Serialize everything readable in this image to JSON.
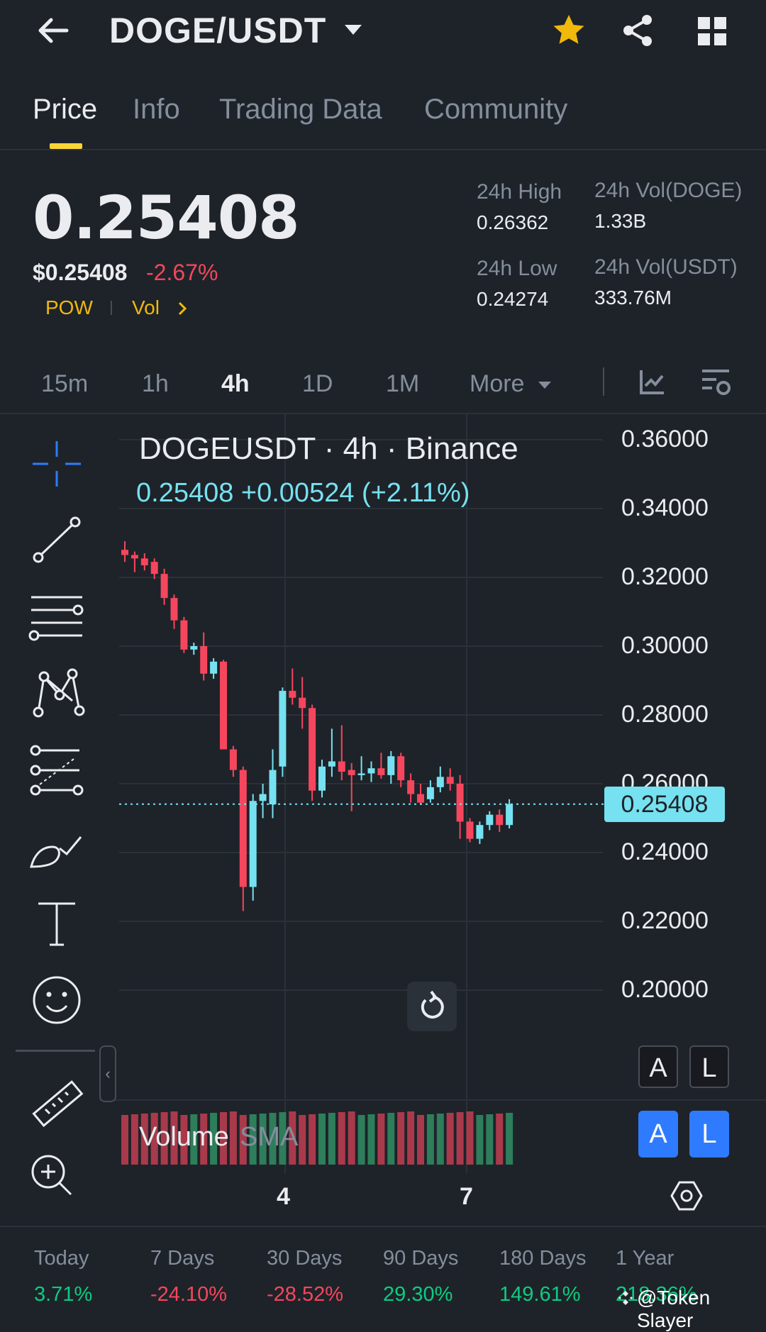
{
  "header": {
    "pair": "DOGE/USDT"
  },
  "tabs": [
    {
      "label": "Price",
      "active": true
    },
    {
      "label": "Info"
    },
    {
      "label": "Trading Data"
    },
    {
      "label": "Community"
    }
  ],
  "ticker": {
    "last_price": "0.25408",
    "usd_price": "$0.25408",
    "change": "-2.67%",
    "tag_pow": "POW",
    "tag_vol": "Vol",
    "stats": {
      "high_label": "24h High",
      "high": "0.26362",
      "low_label": "24h Low",
      "low": "0.24274",
      "vol_base_label": "24h Vol(DOGE)",
      "vol_base": "1.33B",
      "vol_quote_label": "24h Vol(USDT)",
      "vol_quote": "333.76M"
    }
  },
  "intervals": [
    "15m",
    "1h",
    "4h",
    "1D",
    "1M",
    "More"
  ],
  "active_interval": "4h",
  "chart": {
    "title": "DOGEUSDT · 4h · Binance",
    "legend": "0.25408  +0.00524 (+2.11%)",
    "current_price_tag": "0.25408",
    "volume_label": "Volume",
    "sma_label": "SMA",
    "buttons": {
      "a1": "A",
      "l1": "L",
      "a2": "A",
      "l2": "L"
    },
    "x_ticks": [
      "4",
      "7"
    ]
  },
  "chart_data": {
    "type": "candlestick",
    "title": "DOGEUSDT · 4h · Binance",
    "ylim": [
      0.19,
      0.36
    ],
    "y_ticks": [
      "0.36000",
      "0.34000",
      "0.32000",
      "0.30000",
      "0.28000",
      "0.26000",
      "0.24000",
      "0.22000",
      "0.20000"
    ],
    "x_ticks": [
      "4",
      "7"
    ],
    "colors": {
      "up": "#76e1f0",
      "down": "#f6465d",
      "vol_up": "#2e7d5b",
      "vol_down": "#a93a4b"
    },
    "candles": [
      {
        "o": 0.328,
        "h": 0.3305,
        "l": 0.3245,
        "c": 0.3265
      },
      {
        "o": 0.3265,
        "h": 0.3275,
        "l": 0.3215,
        "c": 0.3255
      },
      {
        "o": 0.3255,
        "h": 0.327,
        "l": 0.322,
        "c": 0.3235
      },
      {
        "o": 0.3245,
        "h": 0.3255,
        "l": 0.3195,
        "c": 0.321
      },
      {
        "o": 0.321,
        "h": 0.3225,
        "l": 0.312,
        "c": 0.314
      },
      {
        "o": 0.314,
        "h": 0.315,
        "l": 0.305,
        "c": 0.3075
      },
      {
        "o": 0.3075,
        "h": 0.3085,
        "l": 0.298,
        "c": 0.299
      },
      {
        "o": 0.299,
        "h": 0.301,
        "l": 0.2975,
        "c": 0.3
      },
      {
        "o": 0.3,
        "h": 0.304,
        "l": 0.29,
        "c": 0.292
      },
      {
        "o": 0.292,
        "h": 0.2965,
        "l": 0.2905,
        "c": 0.2955
      },
      {
        "o": 0.2955,
        "h": 0.296,
        "l": 0.28,
        "c": 0.27
      },
      {
        "o": 0.27,
        "h": 0.271,
        "l": 0.262,
        "c": 0.264
      },
      {
        "o": 0.264,
        "h": 0.265,
        "l": 0.223,
        "c": 0.23
      },
      {
        "o": 0.23,
        "h": 0.257,
        "l": 0.226,
        "c": 0.255
      },
      {
        "o": 0.255,
        "h": 0.26,
        "l": 0.25,
        "c": 0.257
      },
      {
        "o": 0.254,
        "h": 0.27,
        "l": 0.25,
        "c": 0.264
      },
      {
        "o": 0.265,
        "h": 0.288,
        "l": 0.262,
        "c": 0.287
      },
      {
        "o": 0.287,
        "h": 0.2935,
        "l": 0.283,
        "c": 0.285
      },
      {
        "o": 0.285,
        "h": 0.291,
        "l": 0.276,
        "c": 0.282
      },
      {
        "o": 0.282,
        "h": 0.283,
        "l": 0.255,
        "c": 0.258
      },
      {
        "o": 0.258,
        "h": 0.267,
        "l": 0.256,
        "c": 0.265
      },
      {
        "o": 0.265,
        "h": 0.276,
        "l": 0.262,
        "c": 0.2665
      },
      {
        "o": 0.2665,
        "h": 0.277,
        "l": 0.261,
        "c": 0.2635
      },
      {
        "o": 0.264,
        "h": 0.266,
        "l": 0.252,
        "c": 0.2625
      },
      {
        "o": 0.2625,
        "h": 0.268,
        "l": 0.261,
        "c": 0.263
      },
      {
        "o": 0.263,
        "h": 0.2665,
        "l": 0.2605,
        "c": 0.2645
      },
      {
        "o": 0.2645,
        "h": 0.269,
        "l": 0.2615,
        "c": 0.2625
      },
      {
        "o": 0.2625,
        "h": 0.2695,
        "l": 0.26,
        "c": 0.268
      },
      {
        "o": 0.268,
        "h": 0.269,
        "l": 0.259,
        "c": 0.261
      },
      {
        "o": 0.261,
        "h": 0.263,
        "l": 0.2545,
        "c": 0.257
      },
      {
        "o": 0.257,
        "h": 0.26,
        "l": 0.254,
        "c": 0.2545
      },
      {
        "o": 0.2555,
        "h": 0.261,
        "l": 0.2545,
        "c": 0.259
      },
      {
        "o": 0.259,
        "h": 0.265,
        "l": 0.2575,
        "c": 0.262
      },
      {
        "o": 0.262,
        "h": 0.2645,
        "l": 0.258,
        "c": 0.26
      },
      {
        "o": 0.26,
        "h": 0.2625,
        "l": 0.244,
        "c": 0.249
      },
      {
        "o": 0.249,
        "h": 0.25,
        "l": 0.243,
        "c": 0.244
      },
      {
        "o": 0.244,
        "h": 0.249,
        "l": 0.2425,
        "c": 0.248
      },
      {
        "o": 0.248,
        "h": 0.252,
        "l": 0.2465,
        "c": 0.251
      },
      {
        "o": 0.251,
        "h": 0.2525,
        "l": 0.246,
        "c": 0.248
      },
      {
        "o": 0.248,
        "h": 0.2555,
        "l": 0.247,
        "c": 0.2541
      }
    ],
    "current_price": 0.25408
  },
  "performance": [
    {
      "label": "Today",
      "value": "3.71%",
      "dir": "up"
    },
    {
      "label": "7 Days",
      "value": "-24.10%",
      "dir": "down"
    },
    {
      "label": "30 Days",
      "value": "-28.52%",
      "dir": "down"
    },
    {
      "label": "90 Days",
      "value": "29.30%",
      "dir": "up"
    },
    {
      "label": "180 Days",
      "value": "149.61%",
      "dir": "up"
    },
    {
      "label": "1 Year",
      "value": "218.36%",
      "dir": "up"
    }
  ],
  "watermark": "@Token Slayer",
  "icons": [
    "back-arrow-icon",
    "dropdown-caret-icon",
    "star-icon",
    "share-icon",
    "grid-icon",
    "indicator-icon",
    "chart-settings-icon",
    "crosshair-icon",
    "trendline-icon",
    "parallel-lines-icon",
    "pattern-icon",
    "fib-icon",
    "brush-icon",
    "text-icon",
    "emoji-icon",
    "ruler-icon",
    "zoom-icon",
    "reset-icon",
    "settings-hexagon-icon"
  ]
}
